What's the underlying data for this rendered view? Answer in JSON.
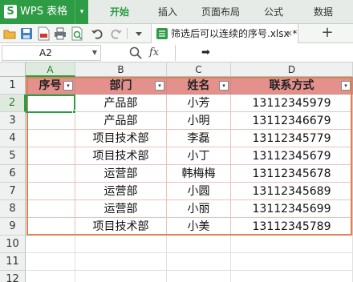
{
  "app": {
    "title": "WPS 表格",
    "logo_letter": "S",
    "accent": "#2e9b45",
    "menu_arrow": "▾"
  },
  "ribbon": {
    "tabs": [
      {
        "label": "开始",
        "active": true
      },
      {
        "label": "插入",
        "active": false
      },
      {
        "label": "页面布局",
        "active": false
      },
      {
        "label": "公式",
        "active": false
      },
      {
        "label": "数据",
        "active": false
      }
    ]
  },
  "toolbar": {
    "icons": [
      "open-folder-icon",
      "save-icon",
      "pdf-export-icon",
      "print-icon",
      "print-preview-icon",
      "undo-icon",
      "redo-icon",
      "dropdown-icon"
    ],
    "document_tab": {
      "label": "筛选后可以连续的序号.xlsx *",
      "close": "×"
    },
    "add_tab": "+"
  },
  "formula_bar": {
    "cell_ref": "A2",
    "fx": "fx",
    "content": "➡"
  },
  "grid": {
    "columns": [
      "A",
      "B",
      "C",
      "D"
    ],
    "rows": [
      "1",
      "2",
      "3",
      "4",
      "5",
      "6",
      "7",
      "8",
      "9",
      "10",
      "11",
      "12"
    ],
    "headers": [
      "序号",
      "部门",
      "姓名",
      "联系方式"
    ],
    "filter_glyph": "▾",
    "data": [
      [
        "",
        "产品部",
        "小芳",
        "13112345979"
      ],
      [
        "",
        "产品部",
        "小明",
        "13112346679"
      ],
      [
        "",
        "项目技术部",
        "李磊",
        "13112345779"
      ],
      [
        "",
        "项目技术部",
        "小丁",
        "13112345679"
      ],
      [
        "",
        "运营部",
        "韩梅梅",
        "13112345678"
      ],
      [
        "",
        "运营部",
        "小圆",
        "13112345689"
      ],
      [
        "",
        "运营部",
        "小丽",
        "13112345699"
      ],
      [
        "",
        "项目技术部",
        "小美",
        "13112345789"
      ]
    ],
    "header_color": "#e4908c",
    "table_border_color": "#d98452",
    "selected_cell": "A2"
  }
}
